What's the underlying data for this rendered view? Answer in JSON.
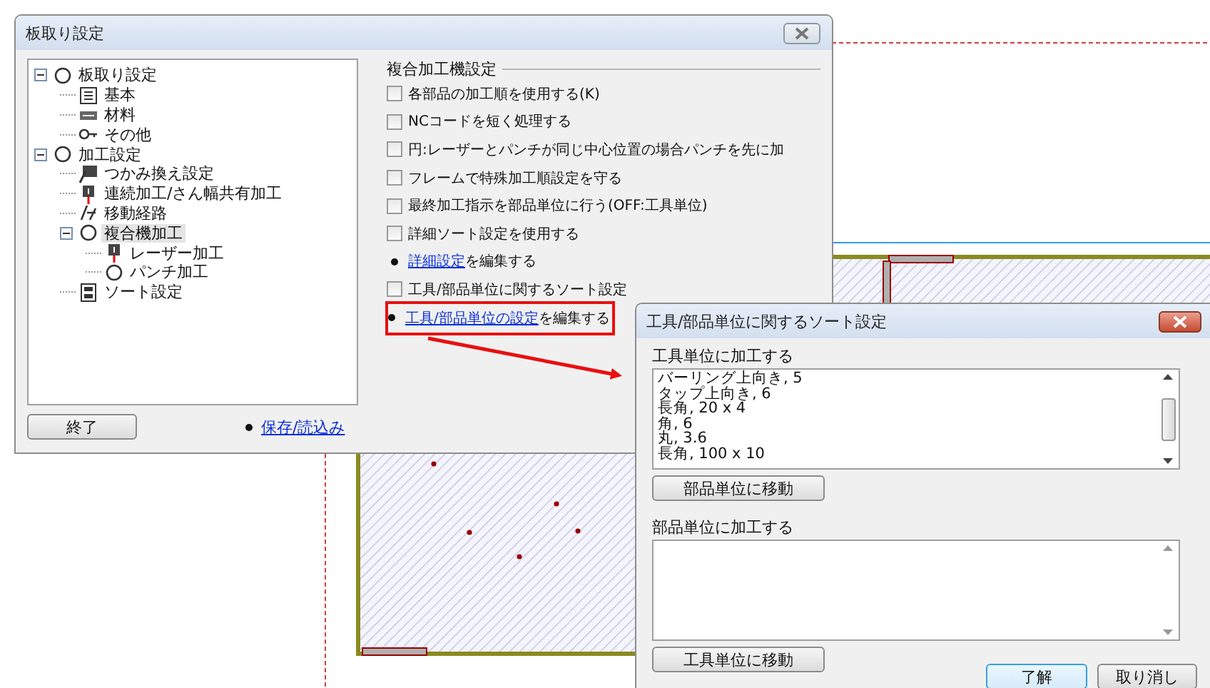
{
  "main_dialog": {
    "title": "板取り設定",
    "tree": [
      {
        "label": "板取り設定",
        "kind": "ring",
        "expanded": true,
        "selected": false,
        "children": [
          {
            "label": "基本",
            "kind": "list",
            "selected": false
          },
          {
            "label": "材料",
            "kind": "ruler",
            "selected": false
          },
          {
            "label": "その他",
            "kind": "key",
            "selected": false
          }
        ]
      },
      {
        "label": "加工設定",
        "kind": "ring",
        "expanded": true,
        "selected": false,
        "children": [
          {
            "label": "つかみ換え設定",
            "kind": "grip",
            "selected": false
          },
          {
            "label": "連続加工/さん幅共有加工",
            "kind": "laser",
            "selected": false
          },
          {
            "label": "移動経路",
            "kind": "path",
            "selected": false
          },
          {
            "label": "複合機加工",
            "kind": "ring",
            "expanded": true,
            "selected": true,
            "children": [
              {
                "label": "レーザー加工",
                "kind": "laser",
                "selected": false
              },
              {
                "label": "パンチ加工",
                "kind": "ring",
                "selected": false
              }
            ]
          },
          {
            "label": "ソート設定",
            "kind": "sort",
            "selected": false
          }
        ]
      }
    ],
    "section_title": "複合加工機設定",
    "options": [
      {
        "kind": "checkbox",
        "label": "各部品の加工順を使用する(K)",
        "checked": false
      },
      {
        "kind": "checkbox",
        "label": "NCコードを短く処理する",
        "checked": false
      },
      {
        "kind": "checkbox",
        "label": "円:レーザーとパンチが同じ中心位置の場合パンチを先に加",
        "checked": false
      },
      {
        "kind": "checkbox",
        "label": "フレームで特殊加工順設定を守る",
        "checked": false
      },
      {
        "kind": "checkbox",
        "label": "最終加工指示を部品単位に行う(OFF:工具単位)",
        "checked": false
      },
      {
        "kind": "checkbox",
        "label": "詳細ソート設定を使用する",
        "checked": false
      },
      {
        "kind": "link",
        "link": "詳細設定",
        "text": "を編集する",
        "highlighted": false
      },
      {
        "kind": "checkbox",
        "label": "工具/部品単位に関するソート設定",
        "checked": false
      },
      {
        "kind": "link",
        "link": "工具/部品単位の設定",
        "text": "を編集する",
        "highlighted": true
      }
    ],
    "close_button": "終了",
    "save_link": "保存/読込み"
  },
  "sort_dialog": {
    "title": "工具/部品単位に関するソート設定",
    "tool_unit": {
      "label": "工具単位に加工する",
      "items": [
        "バーリング上向き, 5",
        "タップ上向き, 6",
        "長角, 20 x 4",
        "角, 6",
        "丸, 3.6",
        "長角, 100 x 10"
      ]
    },
    "move_to_part_button": "部品単位に移動",
    "part_unit": {
      "label": "部品単位に加工する"
    },
    "move_to_tool_button": "工具単位に移動",
    "ok_button": "了解",
    "cancel_button": "取り消し"
  }
}
